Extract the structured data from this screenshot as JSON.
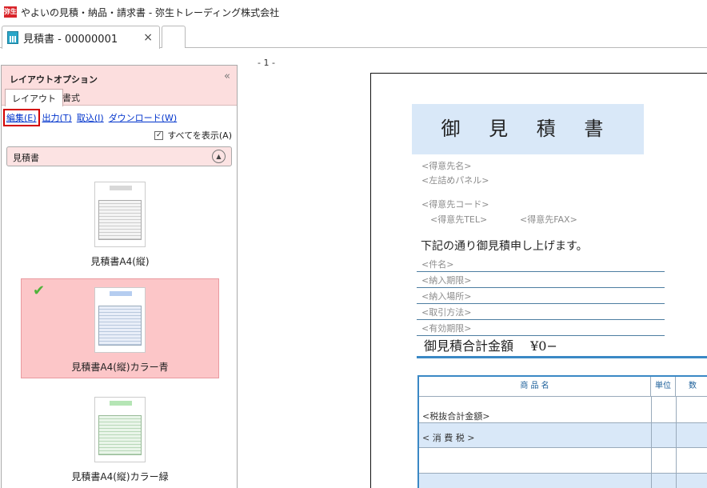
{
  "window": {
    "title": "やよいの見積・納品・請求書 - 弥生トレーディング株式会社",
    "app_icon_text": "弥生"
  },
  "tabs": {
    "active_label": "見積書 - 00000001",
    "close_glyph": "×"
  },
  "panel": {
    "title": "レイアウトオプション",
    "collapse_glyph": "«",
    "tab_layout": "レイアウト",
    "tab_format": "書式",
    "links": {
      "edit": "編集(E)",
      "output": "出力(T)",
      "import": "取込(I)",
      "download": "ダウンロード(W)"
    },
    "show_all": "すべてを表示(A)",
    "show_all_checked": true,
    "section": "見積書",
    "items": [
      {
        "label": "見積書A4(縦)"
      },
      {
        "label": "見積書A4(縦)カラー青",
        "selected": true
      },
      {
        "label": "見積書A4(縦)カラー緑"
      }
    ]
  },
  "preview": {
    "page_number": "- 1 -",
    "doc_title": "御 見 積 書",
    "placeholders": {
      "client_name": "<得意先名>",
      "left_panel": "<左詰めパネル>",
      "client_code": "<得意先コード>",
      "client_tel": "<得意先TEL>",
      "client_fax": "<得意先FAX>"
    },
    "intro": "下記の通り御見積申し上げます。",
    "fields": [
      "<件名>",
      "<納入期限>",
      "<納入場所>",
      "<取引方法>",
      "<有効期限>"
    ],
    "total_label": "御見積合計金額",
    "total_value": "¥0−",
    "table": {
      "headers": [
        "商 品 名",
        "単位",
        "数"
      ],
      "rows": [
        "<税抜合計金額>",
        "< 消 費 税 >",
        "",
        ""
      ]
    }
  }
}
